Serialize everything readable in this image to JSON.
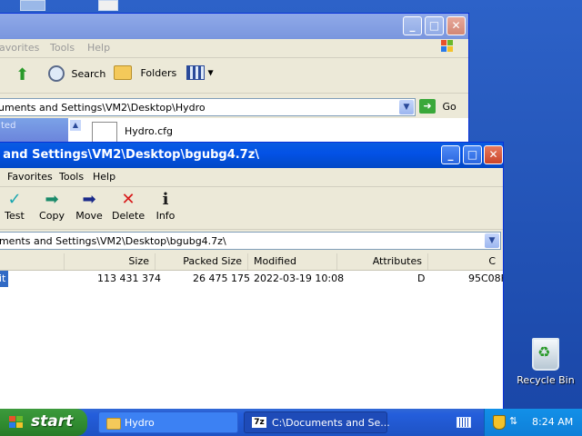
{
  "explorer": {
    "menu": [
      "avorites",
      "Tools",
      "Help"
    ],
    "toolbar": {
      "search": "Search",
      "folders": "Folders"
    },
    "address": "cuments and Settings\\VM2\\Desktop\\Hydro",
    "go": "Go",
    "sidebar_text": "ted",
    "file": "Hydro.cfg"
  },
  "sevenzip": {
    "title": "s and Settings\\VM2\\Desktop\\bgubg4.7z\\",
    "menu": [
      "Favorites",
      "Tools",
      "Help"
    ],
    "tools": [
      "Test",
      "Copy",
      "Move",
      "Delete",
      "Info"
    ],
    "address": "uments and Settings\\VM2\\Desktop\\bgubg4.7z\\",
    "columns": [
      "Size",
      "Packed Size",
      "Modified",
      "Attributes",
      "C"
    ],
    "rows": [
      {
        "name": "it",
        "size": "113 431 374",
        "packed": "26 475 175",
        "modified": "2022-03-19 10:08",
        "attributes": "D",
        "crc": "95C08F"
      }
    ]
  },
  "desktop": {
    "recycle_label": "Recycle Bin"
  },
  "taskbar": {
    "start": "start",
    "tasks": [
      {
        "label": "Hydro",
        "icon": "folder-icon",
        "active": false
      },
      {
        "label": "C:\\Documents and Se...",
        "icon": "7zip-icon",
        "active": true
      }
    ],
    "clock": "8:24 AM"
  },
  "colors": {
    "titlebar": "#0352e6",
    "taskbar": "#245edc",
    "start": "#2f8a2f",
    "tray": "#0f7fd8"
  }
}
